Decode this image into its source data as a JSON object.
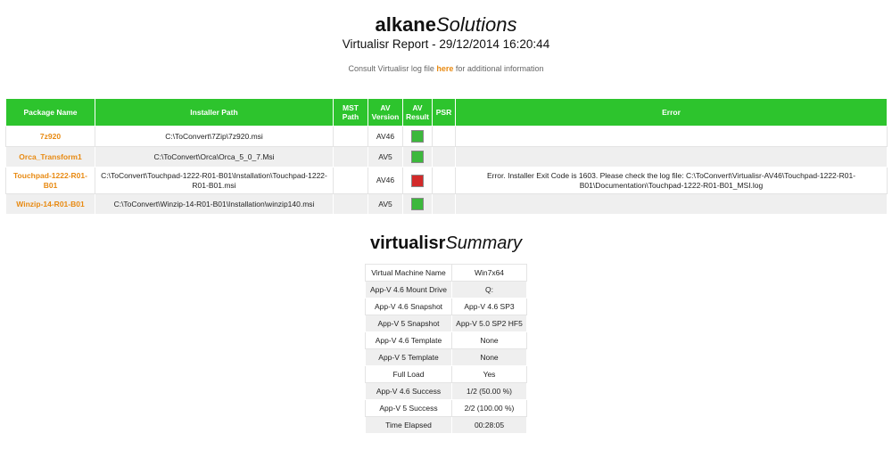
{
  "header": {
    "brand_bold": "alkane",
    "brand_italic": "Solutions",
    "report_title": "Virtualisr Report - 29/12/2014 16:20:44",
    "consult_prefix": "Consult Virtualisr log file ",
    "consult_link": "here",
    "consult_suffix": " for additional information"
  },
  "results": {
    "columns": {
      "package_name": "Package Name",
      "installer_path": "Installer Path",
      "mst_path": "MST Path",
      "av_version": "AV Version",
      "av_result": "AV Result",
      "psr": "PSR",
      "error": "Error"
    },
    "rows": [
      {
        "package": "7z920",
        "installer": "C:\\ToConvert\\7Zip\\7z920.msi",
        "mst": "",
        "av": "AV46",
        "result": "success",
        "psr": "",
        "error": ""
      },
      {
        "package": "Orca_Transform1",
        "installer": "C:\\ToConvert\\Orca\\Orca_5_0_7.Msi",
        "mst": "",
        "av": "AV5",
        "result": "success",
        "psr": "",
        "error": ""
      },
      {
        "package": "Touchpad-1222-R01-B01",
        "installer": "C:\\ToConvert\\Touchpad-1222-R01-B01\\Installation\\Touchpad-1222-R01-B01.msi",
        "mst": "",
        "av": "AV46",
        "result": "failure",
        "psr": "",
        "error": "Error. Installer Exit Code is 1603. Please check the log file: C:\\ToConvert\\Virtualisr-AV46\\Touchpad-1222-R01-B01\\Documentation\\Touchpad-1222-R01-B01_MSI.log"
      },
      {
        "package": "Winzip-14-R01-B01",
        "installer": "C:\\ToConvert\\Winzip-14-R01-B01\\Installation\\winzip140.msi",
        "mst": "",
        "av": "AV5",
        "result": "success",
        "psr": "",
        "error": ""
      }
    ]
  },
  "colors": {
    "header_green": "#2dc42d",
    "package_orange": "#e88a12",
    "success": "#3cb83c",
    "failure": "#d22a2a"
  },
  "summary": {
    "title_bold": "virtualisr",
    "title_italic": "Summary",
    "rows": [
      {
        "label": "Virtual Machine Name",
        "value": "Win7x64"
      },
      {
        "label": "App-V 4.6 Mount Drive",
        "value": "Q:"
      },
      {
        "label": "App-V 4.6 Snapshot",
        "value": "App-V 4.6 SP3"
      },
      {
        "label": "App-V 5 Snapshot",
        "value": "App-V 5.0 SP2 HF5"
      },
      {
        "label": "App-V 4.6 Template",
        "value": "None"
      },
      {
        "label": "App-V 5 Template",
        "value": "None"
      },
      {
        "label": "Full Load",
        "value": "Yes"
      },
      {
        "label": "App-V 4.6 Success",
        "value": "1/2 (50.00 %)"
      },
      {
        "label": "App-V 5 Success",
        "value": "2/2 (100.00 %)"
      },
      {
        "label": "Time Elapsed",
        "value": "00:28:05"
      }
    ]
  }
}
